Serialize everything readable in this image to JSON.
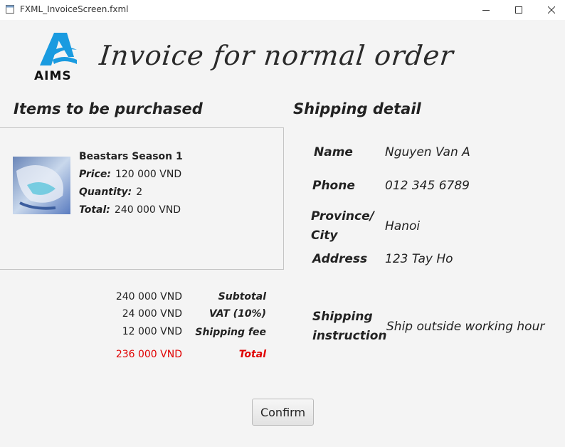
{
  "window": {
    "title": "FXML_InvoiceScreen.fxml"
  },
  "header": {
    "logo_text": "AIMS",
    "title": "Invoice for normal order"
  },
  "items_section": {
    "heading": "Items to be purchased",
    "items": [
      {
        "name": "Beastars Season 1",
        "price_label": "Price:",
        "price": "120 000 VND",
        "quantity_label": "Quantity:",
        "quantity": "2",
        "total_label": "Total:",
        "total": "240 000 VND"
      }
    ]
  },
  "totals": {
    "subtotal_value": "240 000 VND",
    "subtotal_label": "Subtotal",
    "vat_value": "24 000 VND",
    "vat_label": "VAT (10%)",
    "shipping_value": "12 000 VND",
    "shipping_label": "Shipping fee",
    "total_value": "236 000 VND",
    "total_label": "Total"
  },
  "shipping": {
    "heading": "Shipping detail",
    "name_label": "Name",
    "name": "Nguyen Van A",
    "phone_label": "Phone",
    "phone": "012 345 6789",
    "province_label_1": "Province/",
    "province_label_2": "City",
    "province": "Hanoi",
    "address_label": "Address",
    "address": "123 Tay Ho",
    "instruction_label_1": "Shipping",
    "instruction_label_2": "instruction",
    "instruction": "Ship outside working hour"
  },
  "actions": {
    "confirm_label": "Confirm"
  },
  "colors": {
    "accent_blue": "#1a9be0",
    "total_red": "#e00000"
  }
}
